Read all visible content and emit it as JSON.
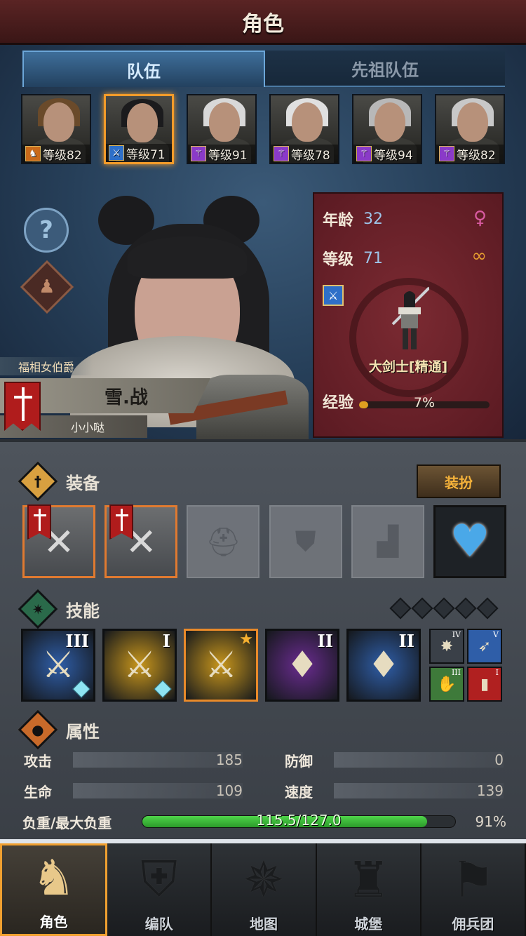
{
  "header": {
    "title": "角色"
  },
  "tabs": [
    {
      "label": "队伍",
      "active": true
    },
    {
      "label": "先祖队伍",
      "active": false
    }
  ],
  "roster": [
    {
      "level": "等级82",
      "class_icon": "horse-icon",
      "class_color": "#c96a1a",
      "hair": "#6a4a2a",
      "selected": false
    },
    {
      "level": "等级71",
      "class_icon": "sword-icon",
      "class_color": "#2e6fc8",
      "hair": "#1b1b1d",
      "selected": true
    },
    {
      "level": "等级91",
      "class_icon": "staff-icon",
      "class_color": "#8a3ac8",
      "hair": "#d8d8d8",
      "selected": false
    },
    {
      "level": "等级78",
      "class_icon": "staff-icon",
      "class_color": "#8a3ac8",
      "hair": "#e0e0e0",
      "selected": false
    },
    {
      "level": "等级94",
      "class_icon": "staff-icon",
      "class_color": "#8a3ac8",
      "hair": "#b8b8b8",
      "selected": false
    },
    {
      "level": "等级82",
      "class_icon": "staff-icon",
      "class_color": "#8a3ac8",
      "hair": "#c8c8c8",
      "selected": false
    }
  ],
  "character": {
    "title": "福相女伯爵",
    "name": "雪.战",
    "subtitle": "小小哒",
    "age_label": "年龄",
    "age": "32",
    "level_label": "等级",
    "level": "71",
    "class_name": "大剑士[精通]",
    "exp_label": "经验",
    "exp_percent": "7%",
    "exp_fraction": 0.07,
    "gender_icon": "female-icon",
    "ring_icon": "rings-icon"
  },
  "equipment": {
    "label": "装备",
    "dress_button": "装扮",
    "slots": [
      {
        "name": "weapon-slot-1",
        "icon": "axe-icon",
        "filled": true
      },
      {
        "name": "weapon-slot-2",
        "icon": "axe-icon",
        "filled": true
      },
      {
        "name": "helmet-slot",
        "icon": "helmet-icon",
        "filled": false
      },
      {
        "name": "armor-slot",
        "icon": "armor-icon",
        "filled": false
      },
      {
        "name": "boots-slot",
        "icon": "boots-icon",
        "filled": false
      },
      {
        "name": "accessory-slot",
        "icon": "heart-amulet-icon",
        "filled": true
      }
    ]
  },
  "skills": {
    "label": "技能",
    "big": [
      {
        "rank": "III",
        "color": "#2f5ea8",
        "glyph": "⚔",
        "diamond": true,
        "selected": false
      },
      {
        "rank": "I",
        "color": "#c8961c",
        "glyph": "⚔",
        "diamond": true,
        "selected": false
      },
      {
        "rank": "",
        "color": "#c8961c",
        "glyph": "⚔",
        "diamond": false,
        "selected": true,
        "star": true
      },
      {
        "rank": "II",
        "color": "#6a2c90",
        "glyph": "♦",
        "diamond": false,
        "selected": false
      },
      {
        "rank": "II",
        "color": "#2f5ea8",
        "glyph": "♦",
        "diamond": false,
        "selected": false
      }
    ],
    "small": [
      {
        "rank": "IV",
        "color": "#3a4048",
        "glyph": "✸"
      },
      {
        "rank": "V",
        "color": "#2f5ea8",
        "glyph": "➶"
      },
      {
        "rank": "III",
        "color": "#3e7a3a",
        "glyph": "✋"
      },
      {
        "rank": "I",
        "color": "#b02020",
        "glyph": "▮"
      }
    ]
  },
  "attributes": {
    "label": "属性",
    "attack_label": "攻击",
    "attack": "185",
    "defense_label": "防御",
    "defense": "0",
    "hp_label": "生命",
    "hp": "109",
    "speed_label": "速度",
    "speed": "139",
    "load_label": "负重/最大负重",
    "load_value": "115.5/127.0",
    "load_percent": "91%",
    "load_fraction": 0.91
  },
  "nav": [
    {
      "label": "角色",
      "icon": "knight-icon",
      "glyph": "♞",
      "active": true
    },
    {
      "label": "编队",
      "icon": "helmet-formation-icon",
      "glyph": "⛨",
      "active": false
    },
    {
      "label": "地图",
      "icon": "compass-icon",
      "glyph": "✵",
      "active": false
    },
    {
      "label": "城堡",
      "icon": "castle-icon",
      "glyph": "♜",
      "active": false
    },
    {
      "label": "佣兵团",
      "icon": "mercenary-icon",
      "glyph": "⚑",
      "active": false
    }
  ]
}
